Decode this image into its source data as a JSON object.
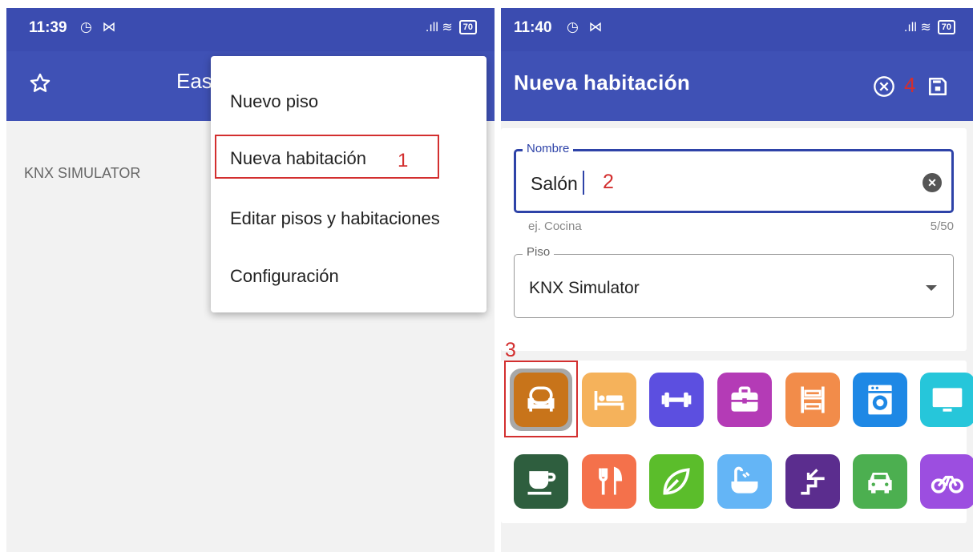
{
  "left_screen": {
    "status": {
      "time": "11:39",
      "icons": "◷ ⋈",
      "signal": ".ıll ≋",
      "battery": "70"
    },
    "app_bar": {
      "star_icon": "star-outline-icon",
      "title_fragment": "Eas"
    },
    "content": {
      "floor_label": "KNX SIMULATOR"
    },
    "menu": {
      "items": [
        {
          "label": "Nuevo piso"
        },
        {
          "label": "Nueva habitación",
          "annotation": "1"
        },
        {
          "label": "Editar pisos y habitaciones"
        },
        {
          "label": "Configuración"
        }
      ]
    }
  },
  "right_screen": {
    "status": {
      "time": "11:40",
      "icons": "◷ ⋈",
      "signal": ".ıll ≋",
      "battery": "70"
    },
    "app_bar": {
      "title": "Nueva habitación",
      "cancel_icon": "cancel-circle-icon",
      "save_icon": "save-floppy-icon",
      "annotation": "4"
    },
    "form": {
      "name_field": {
        "label": "Nombre",
        "value": "Salón",
        "annotation": "2",
        "helper": "ej. Cocina",
        "counter": "5/50"
      },
      "floor_field": {
        "label": "Piso",
        "value": "KNX Simulator"
      }
    },
    "icons_annotation": "3",
    "room_icons": [
      {
        "name": "armchair-icon",
        "color": "#c8741a",
        "selected": true
      },
      {
        "name": "bed-icon",
        "color": "#f5b25b"
      },
      {
        "name": "dumbbell-icon",
        "color": "#5c4fe0"
      },
      {
        "name": "briefcase-icon",
        "color": "#b43bb6"
      },
      {
        "name": "bunk-bed-icon",
        "color": "#f28c4a"
      },
      {
        "name": "washing-machine-icon",
        "color": "#1e88e5"
      },
      {
        "name": "monitor-icon",
        "color": "#26c6da"
      },
      {
        "name": "coffee-cup-icon",
        "color": "#2e5e3e"
      },
      {
        "name": "restaurant-icon",
        "color": "#f4714b"
      },
      {
        "name": "leaf-icon",
        "color": "#5bbd2b"
      },
      {
        "name": "bathtub-icon",
        "color": "#64b5f6"
      },
      {
        "name": "stairs-icon",
        "color": "#5b2d8e"
      },
      {
        "name": "car-icon",
        "color": "#4caf50"
      },
      {
        "name": "motorbike-icon",
        "color": "#9c4ee0"
      }
    ]
  }
}
